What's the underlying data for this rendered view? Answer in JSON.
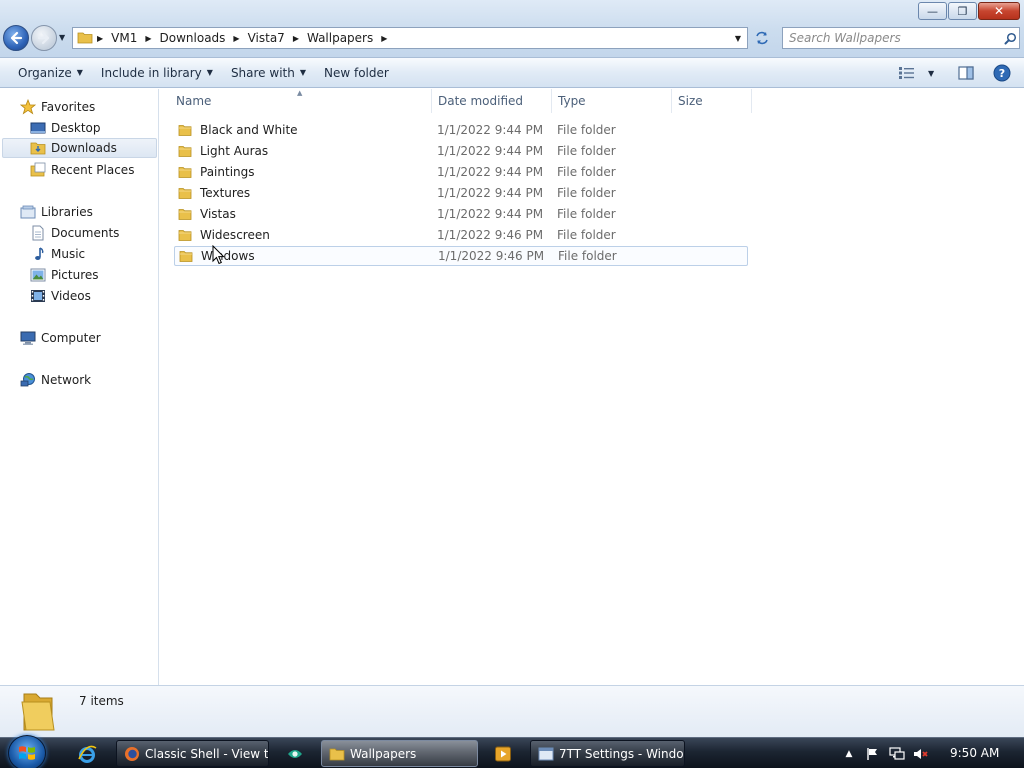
{
  "window": {
    "caption_buttons": {
      "minimize": "minimize",
      "maximize": "restore",
      "close": "close"
    }
  },
  "address": {
    "breadcrumbs": [
      "VM1",
      "Downloads",
      "Vista7",
      "Wallpapers"
    ]
  },
  "search": {
    "placeholder": "Search Wallpapers"
  },
  "commands": {
    "organize": "Organize",
    "include_in_library": "Include in library",
    "share_with": "Share with",
    "new_folder": "New folder"
  },
  "nav": {
    "favorites": "Favorites",
    "desktop": "Desktop",
    "downloads": "Downloads",
    "recent_places": "Recent Places",
    "libraries": "Libraries",
    "documents": "Documents",
    "music": "Music",
    "pictures": "Pictures",
    "videos": "Videos",
    "computer": "Computer",
    "network": "Network"
  },
  "columns": {
    "name": "Name",
    "date_modified": "Date modified",
    "type": "Type",
    "size": "Size"
  },
  "files": [
    {
      "name": "Black and White",
      "date": "1/1/2022 9:44 PM",
      "type": "File folder"
    },
    {
      "name": "Light Auras",
      "date": "1/1/2022 9:44 PM",
      "type": "File folder"
    },
    {
      "name": "Paintings",
      "date": "1/1/2022 9:44 PM",
      "type": "File folder"
    },
    {
      "name": "Textures",
      "date": "1/1/2022 9:44 PM",
      "type": "File folder"
    },
    {
      "name": "Vistas",
      "date": "1/1/2022 9:44 PM",
      "type": "File folder"
    },
    {
      "name": "Widescreen",
      "date": "1/1/2022 9:46 PM",
      "type": "File folder"
    },
    {
      "name": "Windows",
      "date": "1/1/2022 9:46 PM",
      "type": "File folder"
    }
  ],
  "details": {
    "item_count": "7 items"
  },
  "taskbar": {
    "tasks": [
      {
        "label": "Classic Shell - View t..."
      },
      {
        "label": "Wallpapers"
      },
      {
        "label": "7TT Settings - Windo..."
      }
    ],
    "clock": "9:50 AM"
  },
  "colors": {
    "folder": "#e9c04a",
    "selection_border": "#bcd0e8",
    "accent": "#2f6ab5"
  }
}
